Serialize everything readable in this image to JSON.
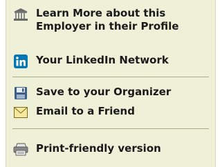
{
  "links": {
    "profile": {
      "icon": "building-icon",
      "line1": "Learn More about this",
      "line2": "Employer in their Profile"
    },
    "linkedin": {
      "icon": "linkedin-icon",
      "label": "Your LinkedIn Network",
      "brand_color": "#0077b5"
    },
    "organizer": {
      "icon": "floppy-disk-icon",
      "label": "Save to your Organizer"
    },
    "email": {
      "icon": "envelope-icon",
      "label": "Email to a Friend"
    },
    "print": {
      "icon": "printer-icon",
      "label": "Print-friendly version"
    }
  },
  "colors": {
    "panel_bg": "#eef0d8",
    "divider": "#a7ad82",
    "text": "#1a1a1a"
  }
}
